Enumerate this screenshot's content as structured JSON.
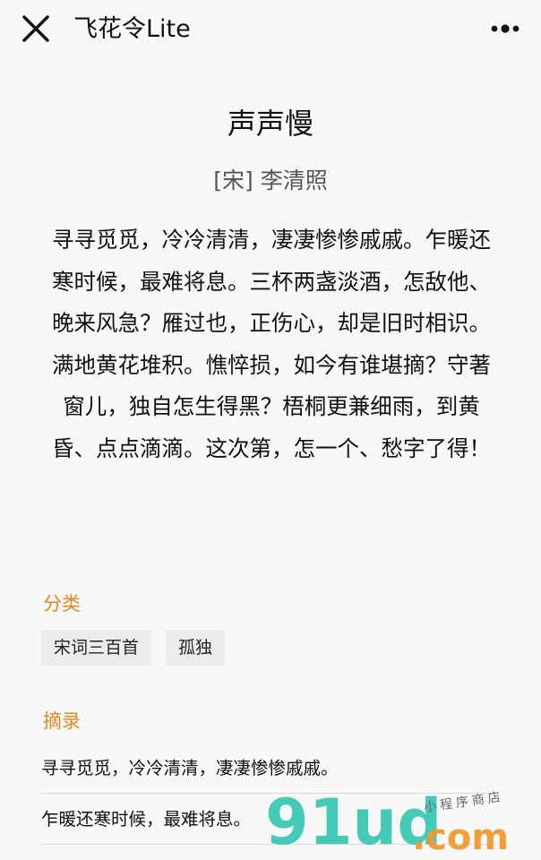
{
  "header": {
    "title": "飞花令Lite",
    "close_icon": "close-icon",
    "more_icon": "more-dots-icon"
  },
  "poem": {
    "title": "声声慢",
    "author": "[宋] 李清照",
    "paragraphs": [
      "寻寻觅觅，冷冷清清，凄凄惨惨戚戚。乍暖还寒时候，最难将息。三杯两盏淡酒，怎敌他、晚来风急？雁过也，正伤心，却是旧时相识。",
      "满地黄花堆积。憔悴损，如今有谁堪摘？守著窗儿，独自怎生得黑？梧桐更兼细雨，到黄昏、点点滴滴。这次第，怎一个、愁字了得！"
    ]
  },
  "category": {
    "label": "分类",
    "tags": [
      "宋词三百首",
      "孤独"
    ]
  },
  "excerpt": {
    "label": "摘录",
    "items": [
      "寻寻觅觅，冷冷清清，凄凄惨惨戚戚。",
      "乍暖还寒时候，最难将息。"
    ]
  },
  "watermark": {
    "logo": "91ud",
    "domain": ".com",
    "tagline": "小程序商店"
  },
  "colors": {
    "accent": "#e08a1e",
    "tag_bg": "#ececec",
    "background": "#f8f8f8",
    "watermark_teal": "#3cc8b4",
    "watermark_orange": "#f29a2e"
  }
}
